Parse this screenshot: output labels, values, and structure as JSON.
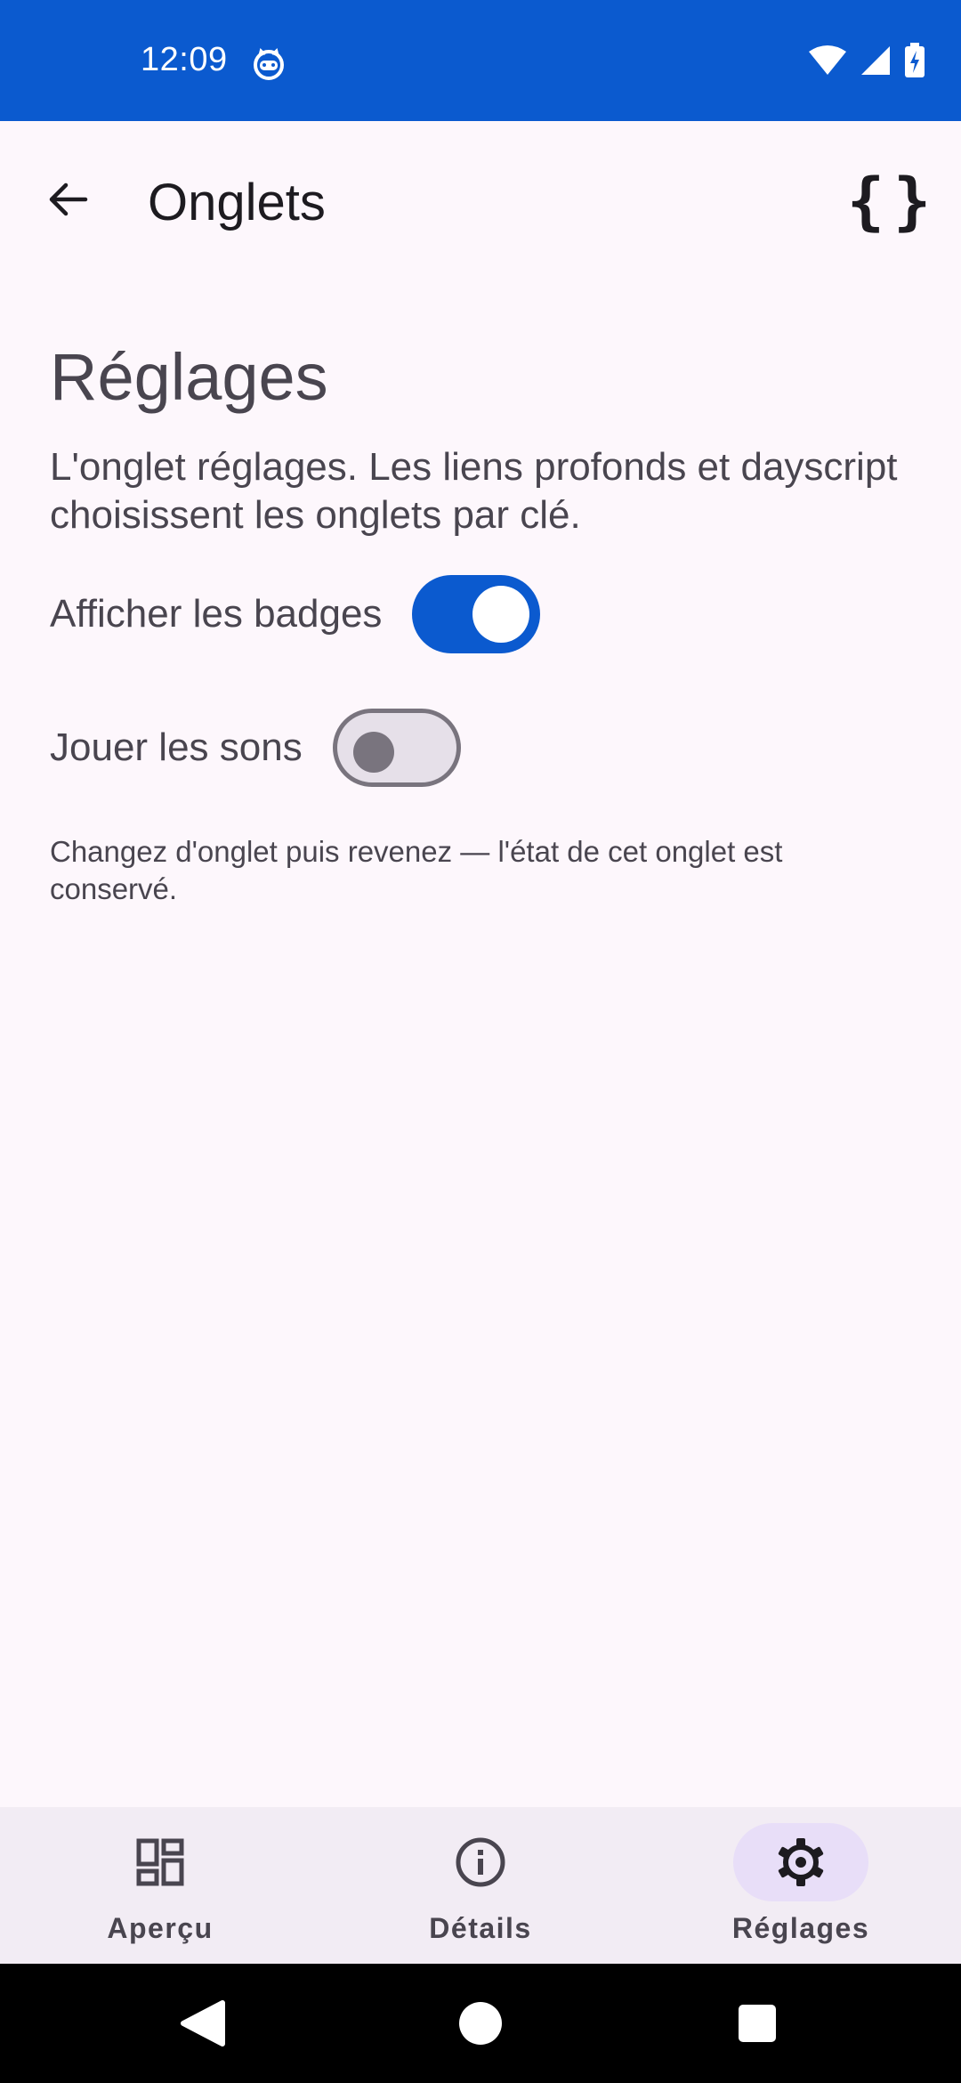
{
  "status_bar": {
    "time": "12:09",
    "icons": [
      "cat-notification-icon",
      "wifi-icon",
      "cell-signal-icon",
      "battery-charging-icon"
    ]
  },
  "app_bar": {
    "title": "Onglets",
    "back_icon": "arrow-back-icon",
    "action_icon": "code-braces-icon",
    "action_glyph": "{}"
  },
  "settings": {
    "heading": "Réglages",
    "description": "L'onglet réglages. Les liens profonds et dayscript choisissent les onglets par clé.",
    "toggles": [
      {
        "label": "Afficher les badges",
        "checked": true
      },
      {
        "label": "Jouer les sons",
        "checked": false
      }
    ],
    "note": "Changez d'onglet puis revenez — l'état de cet onglet est conservé."
  },
  "bottom_nav": {
    "items": [
      {
        "label": "Aperçu",
        "icon": "dashboard-icon",
        "selected": false
      },
      {
        "label": "Détails",
        "icon": "info-icon",
        "selected": false
      },
      {
        "label": "Réglages",
        "icon": "settings-gear-icon",
        "selected": true
      }
    ]
  },
  "system_nav": {
    "buttons": [
      "back-triangle-icon",
      "home-circle-icon",
      "recents-square-icon"
    ]
  },
  "colors": {
    "primary": "#0b5acf",
    "background": "#fdf7fc",
    "nav_background": "#f2ecf4",
    "active_indicator": "#e8def8"
  }
}
